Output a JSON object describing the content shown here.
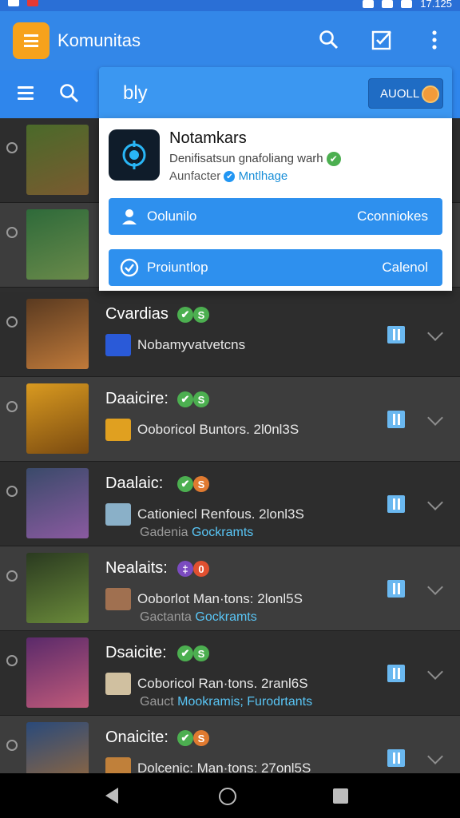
{
  "status_bar": {
    "time": "17.125"
  },
  "app_bar": {
    "title": "Komunitas"
  },
  "search_bar": {
    "query": "bly",
    "button_label": "AUOLL"
  },
  "popup": {
    "title": "Notamkars",
    "description": "Denifisatsun gnafoliang warh",
    "meta_label": "Aunfacter",
    "meta_link": "Mntlhage",
    "button1": {
      "label": "Oolunilo",
      "right_label": "Cconniokes"
    },
    "button2": {
      "label": "Proiuntlop",
      "right_label": "Calenol"
    }
  },
  "list": [
    {
      "title": "Cvardias",
      "badge1": "✔",
      "badge2": "S",
      "badge2_color": "#4caf50",
      "line1": "Nobamyvatvetcns",
      "line2_gray": "",
      "line2_blue": "",
      "thumb_colors": [
        "#5a3a20",
        "#c07a3a"
      ]
    },
    {
      "title": "Daaicire:",
      "badge1": "✔",
      "badge2": "S",
      "badge2_color": "#4caf50",
      "line1": "Ooboricol Buntors. 2l0nl3S",
      "line2_gray": "",
      "line2_blue": "",
      "thumb_colors": [
        "#d99a20",
        "#7a4a10"
      ]
    },
    {
      "title": "Daalaic:",
      "badge1": "✔",
      "badge2": "S",
      "badge2_color": "#e07a30",
      "line1": "Cationiecl Renfous. 2lonl3S",
      "line2_gray": "Gadenia",
      "line2_blue": "Gockramts",
      "thumb_colors": [
        "#3a4a6a",
        "#8a5aa0"
      ]
    },
    {
      "title": "Nealaits:",
      "badge1": "‡",
      "badge2": "0",
      "badge2_color": "#e05030",
      "badge1_color": "#7b4bc0",
      "line1": "Ooborlot Man·tons: 2lonl5S",
      "line2_gray": "Gactanta",
      "line2_blue": "Gockramts",
      "thumb_colors": [
        "#2a3a20",
        "#6a8a3a"
      ]
    },
    {
      "title": "Dsaicite:",
      "badge1": "✔",
      "badge2": "S",
      "badge2_color": "#4caf50",
      "line1": "Coboricol Ran·tons. 2ranl6S",
      "line2_gray": "Gauct",
      "line2_blue": "Mookramis;",
      "line2_blue2": "Furodrtants",
      "thumb_colors": [
        "#5a2a6a",
        "#c05a7a"
      ]
    },
    {
      "title": "Onaicite:",
      "badge1": "✔",
      "badge2": "S",
      "badge2_color": "#e07a30",
      "line1": "Dolcenic: Man·tons: 27onl5S",
      "line2_gray": "",
      "line2_blue": "",
      "thumb_colors": [
        "#2a4a7a",
        "#9a6a3a"
      ]
    }
  ],
  "colors": {
    "app_bar": "#3387e8",
    "accent": "#2e90ee",
    "badge_green": "#4caf50"
  }
}
